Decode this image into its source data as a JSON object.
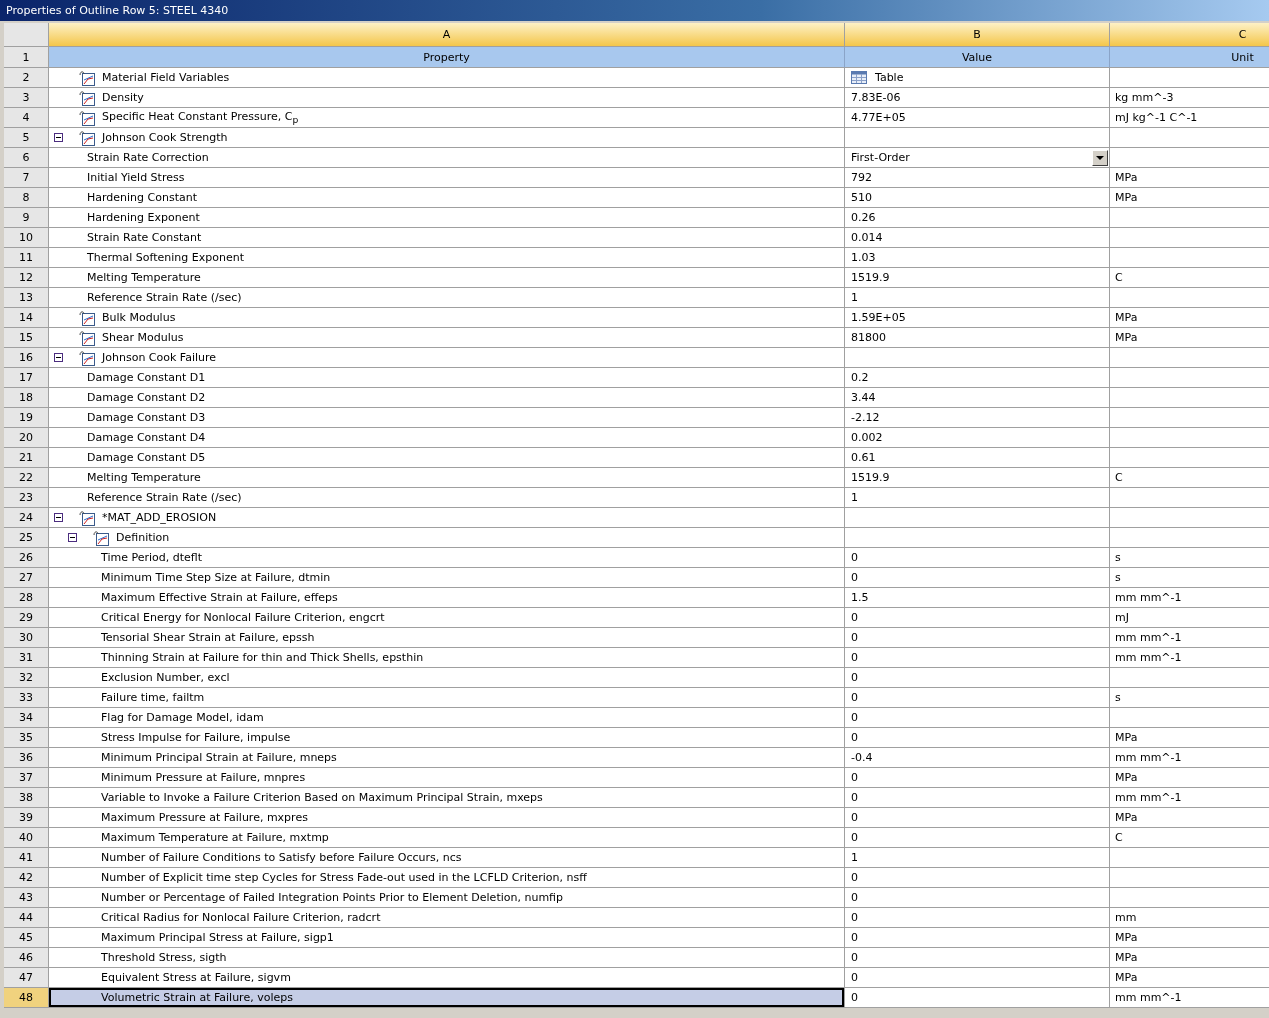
{
  "window": {
    "title": "Properties of Outline Row 5: STEEL 4340"
  },
  "table": {
    "column_letters": [
      "A",
      "B",
      "C"
    ],
    "header_row": {
      "number": "1",
      "cells": [
        "Property",
        "Value",
        "Unit"
      ]
    },
    "rows": [
      {
        "number": "2",
        "kind": "property",
        "property": "Material Field Variables",
        "value": {
          "kind": "table",
          "text": "Table"
        },
        "selected": false
      },
      {
        "number": "3",
        "kind": "property",
        "property": "Density",
        "value": "7.83E-06",
        "unit": "kg mm^-3",
        "selected": false
      },
      {
        "number": "4",
        "kind": "property",
        "property": "Specific Heat Constant Pressure, C$_{p}$",
        "value": "4.77E+05",
        "unit": "mJ kg^-1 C^-1",
        "selected": false
      },
      {
        "number": "5",
        "kind": "group",
        "property": "Johnson Cook Strength",
        "expanded": true,
        "selected": false,
        "children": [
          {
            "number": "6",
            "kind": "field",
            "property": "Strain Rate Correction",
            "value": {
              "kind": "dropdown",
              "text": "First-Order"
            },
            "selected": false
          },
          {
            "number": "7",
            "kind": "field",
            "property": "Initial Yield Stress",
            "value": "792",
            "unit": "MPa",
            "selected": false
          },
          {
            "number": "8",
            "kind": "field",
            "property": "Hardening Constant",
            "value": "510",
            "unit": "MPa",
            "selected": false
          },
          {
            "number": "9",
            "kind": "field",
            "property": "Hardening Exponent",
            "value": "0.26",
            "selected": false
          },
          {
            "number": "10",
            "kind": "field",
            "property": "Strain Rate Constant",
            "value": "0.014",
            "selected": false
          },
          {
            "number": "11",
            "kind": "field",
            "property": "Thermal Softening Exponent",
            "value": "1.03",
            "selected": false
          },
          {
            "number": "12",
            "kind": "field",
            "property": "Melting Temperature",
            "value": "1519.9",
            "unit": "C",
            "selected": false
          },
          {
            "number": "13",
            "kind": "field",
            "property": "Reference Strain Rate (/sec)",
            "value": "1",
            "selected": false
          }
        ]
      },
      {
        "number": "14",
        "kind": "property",
        "property": "Bulk Modulus",
        "value": "1.59E+05",
        "unit": "MPa",
        "selected": false
      },
      {
        "number": "15",
        "kind": "property",
        "property": "Shear Modulus",
        "value": "81800",
        "unit": "MPa",
        "selected": false
      },
      {
        "number": "16",
        "kind": "group",
        "property": "Johnson Cook Failure",
        "expanded": true,
        "selected": false,
        "children": [
          {
            "number": "17",
            "kind": "field",
            "property": "Damage Constant D1",
            "value": "0.2",
            "selected": false
          },
          {
            "number": "18",
            "kind": "field",
            "property": "Damage Constant D2",
            "value": "3.44",
            "selected": false
          },
          {
            "number": "19",
            "kind": "field",
            "property": "Damage Constant D3",
            "value": "-2.12",
            "selected": false
          },
          {
            "number": "20",
            "kind": "field",
            "property": "Damage Constant D4",
            "value": "0.002",
            "selected": false
          },
          {
            "number": "21",
            "kind": "field",
            "property": "Damage Constant D5",
            "value": "0.61",
            "selected": false
          },
          {
            "number": "22",
            "kind": "field",
            "property": "Melting Temperature",
            "value": "1519.9",
            "unit": "C",
            "selected": false
          },
          {
            "number": "23",
            "kind": "field",
            "property": "Reference Strain Rate (/sec)",
            "value": "1",
            "selected": false
          }
        ]
      },
      {
        "number": "24",
        "kind": "group",
        "property": "*MAT_ADD_EROSION",
        "expanded": true,
        "selected": false,
        "children": [
          {
            "number": "25",
            "kind": "group",
            "property": "Definition",
            "expanded": true,
            "selected": false,
            "children": [
              {
                "number": "26",
                "kind": "field",
                "property": "Time Period, dteflt",
                "value": "0",
                "unit": "s",
                "selected": false
              },
              {
                "number": "27",
                "kind": "field",
                "property": "Minimum Time Step Size at Failure, dtmin",
                "value": "0",
                "unit": "s",
                "selected": false
              },
              {
                "number": "28",
                "kind": "field",
                "property": "Maximum Effective Strain at Failure, effeps",
                "value": "1.5",
                "unit": "mm mm^-1",
                "selected": false
              },
              {
                "number": "29",
                "kind": "field",
                "property": "Critical Energy for Nonlocal Failure Criterion, engcrt",
                "value": "0",
                "unit": "mJ",
                "selected": false
              },
              {
                "number": "30",
                "kind": "field",
                "property": "Tensorial Shear Strain at Failure, epssh",
                "value": "0",
                "unit": "mm mm^-1",
                "selected": false
              },
              {
                "number": "31",
                "kind": "field",
                "property": "Thinning Strain at Failure for thin and Thick Shells, epsthin",
                "value": "0",
                "unit": "mm mm^-1",
                "selected": false
              },
              {
                "number": "32",
                "kind": "field",
                "property": "Exclusion Number, excl",
                "value": "0",
                "selected": false
              },
              {
                "number": "33",
                "kind": "field",
                "property": "Failure time, failtm",
                "value": "0",
                "unit": "s",
                "selected": false
              },
              {
                "number": "34",
                "kind": "field",
                "property": "Flag for Damage Model, idam",
                "value": "0",
                "selected": false
              },
              {
                "number": "35",
                "kind": "field",
                "property": "Stress Impulse for Failure, impulse",
                "value": "0",
                "unit": "MPa",
                "selected": false
              },
              {
                "number": "36",
                "kind": "field",
                "property": "Minimum Principal Strain at Failure, mneps",
                "value": "-0.4",
                "unit": "mm mm^-1",
                "selected": false
              },
              {
                "number": "37",
                "kind": "field",
                "property": "Minimum Pressure at Failure, mnpres",
                "value": "0",
                "unit": "MPa",
                "selected": false
              },
              {
                "number": "38",
                "kind": "field",
                "property": "Variable to Invoke a Failure Criterion Based on Maximum Principal Strain, mxeps",
                "value": "0",
                "unit": "mm mm^-1",
                "selected": false
              },
              {
                "number": "39",
                "kind": "field",
                "property": "Maximum Pressure at Failure, mxpres",
                "value": "0",
                "unit": "MPa",
                "selected": false
              },
              {
                "number": "40",
                "kind": "field",
                "property": "Maximum Temperature at Failure, mxtmp",
                "value": "0",
                "unit": "C",
                "selected": false
              },
              {
                "number": "41",
                "kind": "field",
                "property": "Number of Failure Conditions to Satisfy before Failure Occurs, ncs",
                "value": "1",
                "selected": false
              },
              {
                "number": "42",
                "kind": "field",
                "property": "Number of Explicit time step Cycles for Stress Fade-out used in the LCFLD Criterion, nsff",
                "value": "0",
                "selected": false
              },
              {
                "number": "43",
                "kind": "field",
                "property": "Number or Percentage of Failed Integration Points Prior to Element Deletion, numfip",
                "value": "0",
                "selected": false
              },
              {
                "number": "44",
                "kind": "field",
                "property": "Critical Radius for Nonlocal Failure Criterion, radcrt",
                "value": "0",
                "unit": "mm",
                "selected": false
              },
              {
                "number": "45",
                "kind": "field",
                "property": "Maximum Principal Stress at Failure, sigp1",
                "value": "0",
                "unit": "MPa",
                "selected": false
              },
              {
                "number": "46",
                "kind": "field",
                "property": "Threshold Stress, sigth",
                "value": "0",
                "unit": "MPa",
                "selected": false
              },
              {
                "number": "47",
                "kind": "field",
                "property": "Equivalent Stress at Failure, sigvm",
                "value": "0",
                "unit": "MPa",
                "selected": false
              },
              {
                "number": "48",
                "kind": "field",
                "property": "Volumetric Strain at Failure, voleps",
                "value": "0",
                "unit": "mm mm^-1",
                "selected": true
              }
            ]
          }
        ]
      }
    ]
  }
}
